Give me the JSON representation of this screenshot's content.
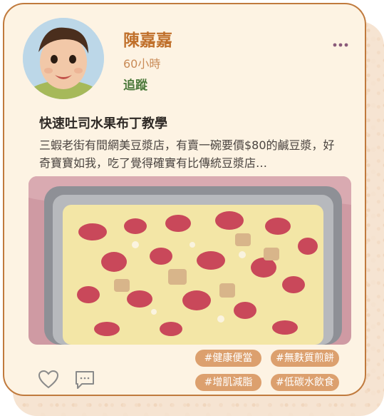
{
  "author": {
    "name": "陳嘉嘉",
    "time": "60小時",
    "follow_label": "追蹤"
  },
  "post": {
    "title": "快速吐司水果布丁教學",
    "excerpt": "三蝦老街有間網美豆漿店，有賣一碗要價$80的鹹豆漿，好奇寶寶如我，吃了覺得確實有比傳統豆漿店…"
  },
  "tags": [
    "#健康便當",
    "#無麩質煎餅",
    "#增肌減脂",
    "#低碳水飲食"
  ],
  "icons": {
    "more": "more-horizontal-icon",
    "like": "heart-icon",
    "comment": "comment-icon"
  },
  "colors": {
    "accent": "#c0702b",
    "card_bg": "#fdf3e3",
    "tag_bg": "#dca06e",
    "follow": "#4d7a3c"
  }
}
